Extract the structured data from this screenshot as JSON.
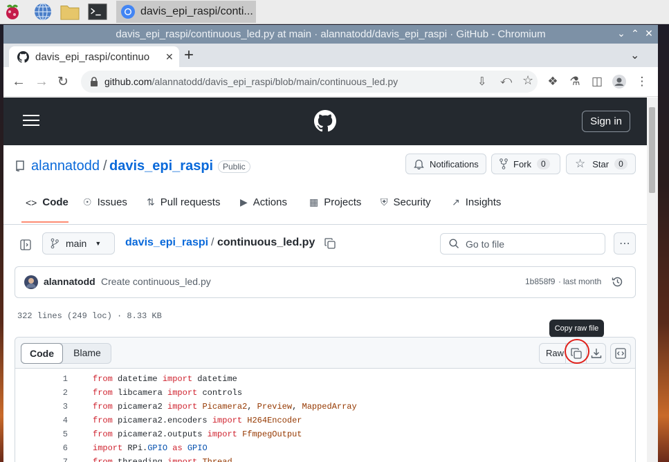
{
  "taskbar": {
    "task_label": "davis_epi_raspi/conti..."
  },
  "window": {
    "title": "davis_epi_raspi/continuous_led.py at main · alannatodd/davis_epi_raspi · GitHub - Chromium",
    "tab_title": "davis_epi_raspi/continuo",
    "url_host": "github.com",
    "url_path": "/alannatodd/davis_epi_raspi/blob/main/continuous_led.py"
  },
  "github": {
    "sign_in_label": "Sign in",
    "owner": "alannatodd",
    "separator": "/",
    "repo": "davis_epi_raspi",
    "visibility": "Public",
    "notifications_label": "Notifications",
    "fork_label": "Fork",
    "fork_count": "0",
    "star_label": "Star",
    "star_count": "0",
    "nav": {
      "code": "Code",
      "issues": "Issues",
      "pull_requests": "Pull requests",
      "actions": "Actions",
      "projects": "Projects",
      "security": "Security",
      "insights": "Insights"
    },
    "branch": "main",
    "breadcrumb_repo": "davis_epi_raspi",
    "breadcrumb_sep": "/",
    "filename": "continuous_led.py",
    "go_to_file_placeholder": "Go to file",
    "commit": {
      "author": "alannatodd",
      "message": "Create continuous_led.py",
      "sha": "1b858f9",
      "dot": "·",
      "time": "last month"
    },
    "file_stats": "322 lines (249 loc) · 8.33 KB",
    "viewer": {
      "code_tab": "Code",
      "blame_tab": "Blame",
      "raw_label": "Raw",
      "tooltip": "Copy raw file"
    },
    "code_lines": [
      {
        "n": "1",
        "parts": [
          {
            "t": "from",
            "c": "kw"
          },
          {
            "t": " datetime ",
            "c": ""
          },
          {
            "t": "import",
            "c": "kw"
          },
          {
            "t": " datetime",
            "c": ""
          }
        ]
      },
      {
        "n": "2",
        "parts": [
          {
            "t": "from",
            "c": "kw"
          },
          {
            "t": " libcamera ",
            "c": ""
          },
          {
            "t": "import",
            "c": "kw"
          },
          {
            "t": " controls",
            "c": ""
          }
        ]
      },
      {
        "n": "3",
        "parts": [
          {
            "t": "from",
            "c": "kw"
          },
          {
            "t": " picamera2 ",
            "c": ""
          },
          {
            "t": "import",
            "c": "kw"
          },
          {
            "t": " ",
            "c": ""
          },
          {
            "t": "Picamera2",
            "c": "cls"
          },
          {
            "t": ", ",
            "c": ""
          },
          {
            "t": "Preview",
            "c": "cls"
          },
          {
            "t": ", ",
            "c": ""
          },
          {
            "t": "MappedArray",
            "c": "cls"
          }
        ]
      },
      {
        "n": "4",
        "parts": [
          {
            "t": "from",
            "c": "kw"
          },
          {
            "t": " picamera2.encoders ",
            "c": ""
          },
          {
            "t": "import",
            "c": "kw"
          },
          {
            "t": " ",
            "c": ""
          },
          {
            "t": "H264Encoder",
            "c": "cls"
          }
        ]
      },
      {
        "n": "5",
        "parts": [
          {
            "t": "from",
            "c": "kw"
          },
          {
            "t": " picamera2.outputs ",
            "c": ""
          },
          {
            "t": "import",
            "c": "kw"
          },
          {
            "t": " ",
            "c": ""
          },
          {
            "t": "FfmpegOutput",
            "c": "cls"
          }
        ]
      },
      {
        "n": "6",
        "parts": [
          {
            "t": "import",
            "c": "kw"
          },
          {
            "t": " RPi.",
            "c": ""
          },
          {
            "t": "GPIO",
            "c": "mod"
          },
          {
            "t": " ",
            "c": ""
          },
          {
            "t": "as",
            "c": "kw"
          },
          {
            "t": " ",
            "c": ""
          },
          {
            "t": "GPIO",
            "c": "mod"
          }
        ]
      },
      {
        "n": "7",
        "parts": [
          {
            "t": "from",
            "c": "kw"
          },
          {
            "t": " threading ",
            "c": ""
          },
          {
            "t": "import",
            "c": "kw"
          },
          {
            "t": " ",
            "c": ""
          },
          {
            "t": "Thread",
            "c": "cls"
          }
        ]
      }
    ]
  }
}
